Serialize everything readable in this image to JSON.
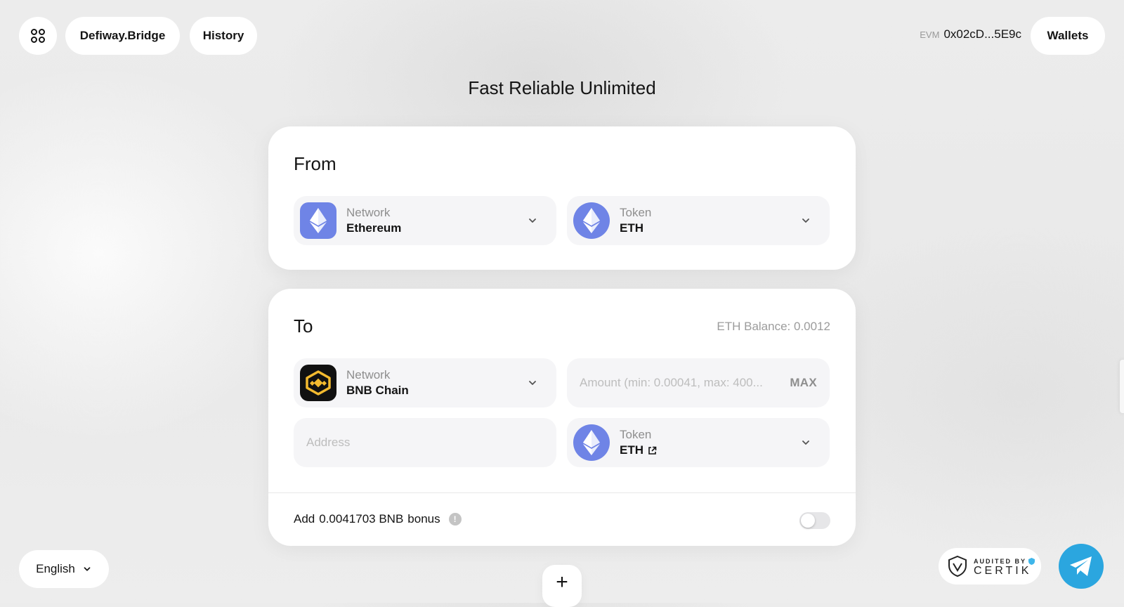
{
  "header": {
    "brand_label": "Defiway.Bridge",
    "history_label": "History",
    "evm_tag": "EVM",
    "wallet_address": "0x02cD...5E9c",
    "wallets_label": "Wallets"
  },
  "page_title": "Fast Reliable Unlimited",
  "from": {
    "title": "From",
    "network": {
      "label": "Network",
      "value": "Ethereum",
      "icon": "ethereum-icon"
    },
    "token": {
      "label": "Token",
      "value": "ETH",
      "icon": "eth-token-icon"
    }
  },
  "to": {
    "title": "To",
    "balance": "ETH Balance: 0.0012",
    "network": {
      "label": "Network",
      "value": "BNB Chain",
      "icon": "bnb-chain-icon"
    },
    "amount_placeholder": "Amount (min: 0.00041, max: 400...",
    "max_label": "MAX",
    "address_placeholder": "Address",
    "token": {
      "label": "Token",
      "value": "ETH",
      "icon": "eth-token-icon"
    }
  },
  "bonus": {
    "prefix": "Add",
    "amount": "0.0041703 BNB",
    "suffix": "bonus",
    "info_glyph": "!",
    "enabled": false
  },
  "footer": {
    "language": "English",
    "add_glyph": "+",
    "certik_small": "AUDITED BY",
    "certik_large": "CERTIK"
  },
  "colors": {
    "eth_icon_bg": "#6f84e6",
    "bnb_icon_bg": "#111111",
    "bnb_gold": "#f3ba2f",
    "telegram_blue": "#2ba6df"
  }
}
